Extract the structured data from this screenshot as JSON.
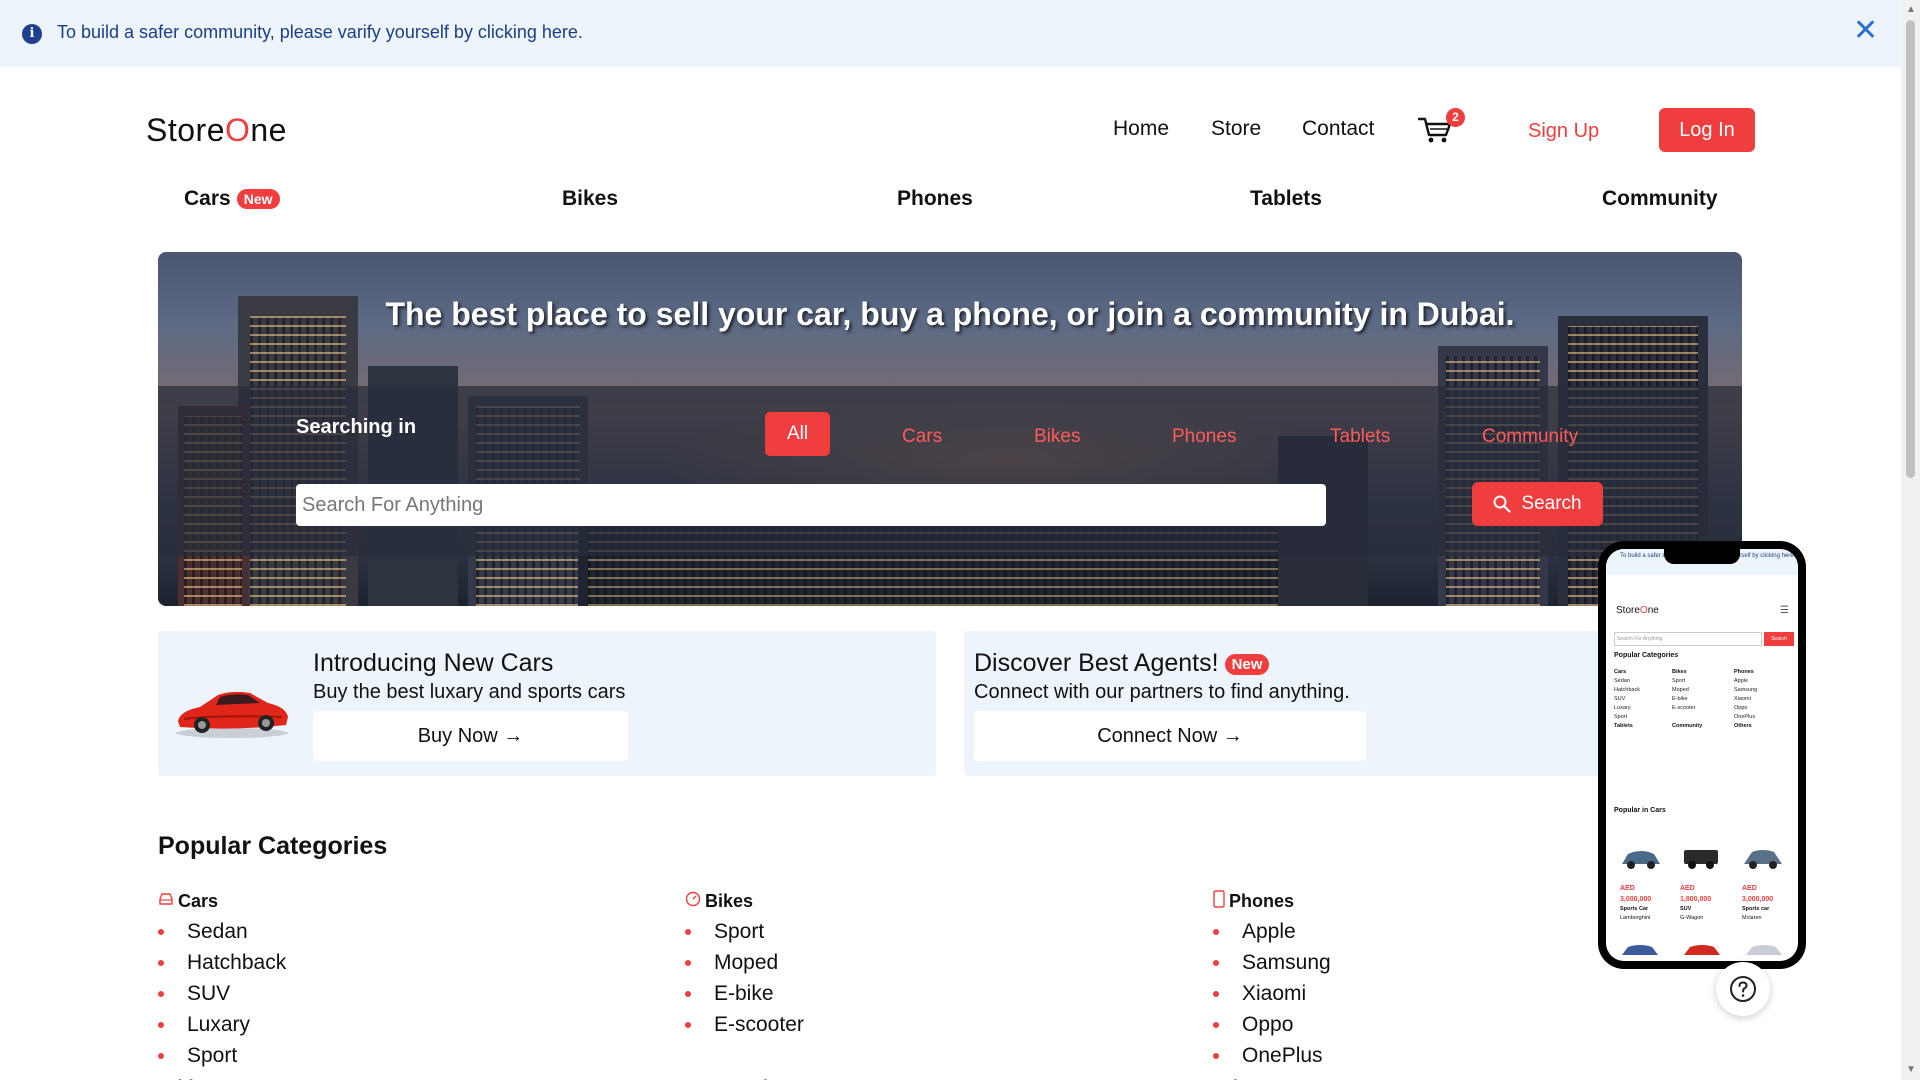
{
  "banner": {
    "message": "To build a safer community, please varify yourself by clicking here.",
    "close_icon": "close-icon"
  },
  "header": {
    "logo_prefix": "Store",
    "logo_o": "O",
    "logo_suffix": "ne",
    "nav": [
      "Home",
      "Store",
      "Contact"
    ],
    "cart_count": "2",
    "signup_label": "Sign Up",
    "login_label": "Log In"
  },
  "categories": {
    "items": [
      "Cars",
      "Bikes",
      "Phones",
      "Tablets",
      "Community"
    ],
    "new_badge": "New"
  },
  "hero": {
    "title": "The best place to sell your car, buy a phone, or join a community in Dubai.",
    "searching_in": "Searching in",
    "scopes": [
      "All",
      "Cars",
      "Bikes",
      "Phones",
      "Tablets",
      "Community"
    ],
    "selected_scope": "All",
    "search_placeholder": "Search For Anything",
    "search_value": "",
    "search_button": "Search"
  },
  "promos": {
    "cars": {
      "title": "Introducing New Cars",
      "subtitle": "Buy the best luxary and sports cars",
      "cta": "Buy Now →"
    },
    "agents": {
      "title": "Discover Best Agents!",
      "badge": "New",
      "subtitle": "Connect with our partners to find anything.",
      "cta": "Connect Now →"
    }
  },
  "popular": {
    "title": "Popular Categories",
    "columns": [
      {
        "heading": "Cars",
        "icon": "car-icon",
        "items": [
          "Sedan",
          "Hatchback",
          "SUV",
          "Luxary",
          "Sport"
        ],
        "next_heading": "Tablets"
      },
      {
        "heading": "Bikes",
        "icon": "speedometer-icon",
        "items": [
          "Sport",
          "Moped",
          "E-bike",
          "E-scooter"
        ],
        "next_heading": "Community"
      },
      {
        "heading": "Phones",
        "icon": "phone-icon",
        "items": [
          "Apple",
          "Samsung",
          "Xiaomi",
          "Oppo",
          "OnePlus"
        ],
        "next_heading": "Others"
      }
    ]
  },
  "mobile_preview": {
    "banner": "To build a safer community, please varify yourself by clicking here.",
    "search_placeholder": "Search For Anything",
    "search_button": "Search",
    "popular_title": "Popular Categories",
    "popular_in_cars": "Popular in Cars",
    "cars": [
      {
        "price_currency": "AED",
        "price": "3,000,000",
        "type": "Sports Car",
        "name": "Lamborghini"
      },
      {
        "price_currency": "AED",
        "price": "1,800,000",
        "type": "SUV",
        "name": "G-Wagon"
      },
      {
        "price_currency": "AED",
        "price": "3,000,000",
        "type": "Sports car",
        "name": "Mclaren"
      }
    ]
  },
  "colors": {
    "accent": "#f03e3e",
    "banner_bg": "#eef4fc",
    "banner_text": "#1a3f86",
    "card_bg": "#eef4fc"
  }
}
